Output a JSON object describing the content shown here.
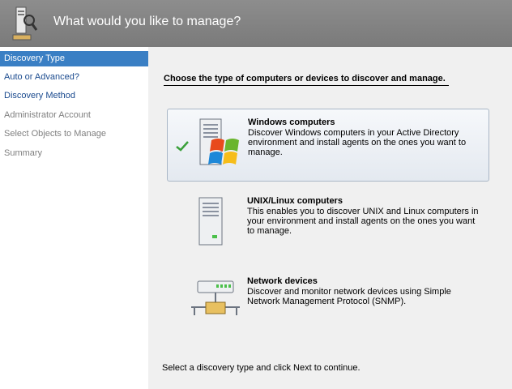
{
  "header": {
    "title": "What would you like to manage?",
    "icon": "wizard-computer-icon"
  },
  "sidebar": {
    "items": [
      {
        "label": "Discovery Type",
        "state": "active"
      },
      {
        "label": "Auto or Advanced?",
        "state": "link"
      },
      {
        "label": "Discovery Method",
        "state": "link"
      },
      {
        "label": "Administrator Account",
        "state": "disabled"
      },
      {
        "label": "Select Objects to Manage",
        "state": "disabled"
      },
      {
        "label": "Summary",
        "state": "disabled"
      }
    ]
  },
  "main": {
    "prompt": "Choose the type of computers or devices to discover and manage.",
    "options": [
      {
        "title": "Windows computers",
        "description": "Discover Windows computers in your Active Directory environment and install agents on the ones you want to manage.",
        "icon": "windows-computer-icon",
        "selected": true
      },
      {
        "title": "UNIX/Linux computers",
        "description": "This enables you to discover UNIX and Linux computers in your environment and install agents on the ones you want to manage.",
        "icon": "unix-computer-icon",
        "selected": false
      },
      {
        "title": "Network devices",
        "description": "Discover and monitor network devices using Simple Network Management Protocol (SNMP).",
        "icon": "network-device-icon",
        "selected": false
      }
    ],
    "footer": "Select a discovery type and click Next to continue."
  },
  "colors": {
    "header": "#858585",
    "nav_active": "#3a7fc4",
    "nav_link": "#1a4a8e",
    "nav_disabled": "#808080",
    "selection_border": "#a9b6c6"
  }
}
